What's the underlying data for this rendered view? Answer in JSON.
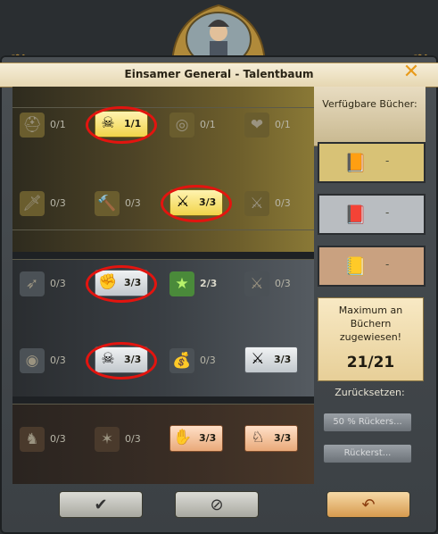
{
  "window": {
    "title": "Einsamer General  - Talentbaum",
    "close_glyph": "✕"
  },
  "talents": [
    {
      "id": "r1c1",
      "icon": "helmet-icon",
      "glyph": "⛑",
      "count": "0/1",
      "state": "locked",
      "tier": "gold"
    },
    {
      "id": "r1c2",
      "icon": "general-portrait-icon",
      "glyph": "☠",
      "count": "1/1",
      "state": "lit",
      "tier": "gold",
      "highlighted": true
    },
    {
      "id": "r1c3",
      "icon": "coin-plus-icon",
      "glyph": "◎",
      "count": "0/1",
      "state": "locked",
      "tier": "gold"
    },
    {
      "id": "r1c4",
      "icon": "heart-icon",
      "glyph": "❤",
      "count": "0/1",
      "state": "locked",
      "tier": "gold"
    },
    {
      "id": "r2c1",
      "icon": "dagger-icon",
      "glyph": "🗡",
      "count": "0/3",
      "state": "locked",
      "tier": "gold"
    },
    {
      "id": "r2c2",
      "icon": "hammer-icon",
      "glyph": "🔨",
      "count": "0/3",
      "state": "locked",
      "tier": "gold"
    },
    {
      "id": "r2c3",
      "icon": "crossed-swords-people-icon",
      "glyph": "⚔",
      "count": "3/3",
      "state": "lit",
      "tier": "gold",
      "highlighted": true
    },
    {
      "id": "r2c4",
      "icon": "swords-clock-icon",
      "glyph": "⚔",
      "count": "0/3",
      "state": "locked",
      "tier": "gold"
    },
    {
      "id": "r3c1",
      "icon": "spearhead-icon",
      "glyph": "➶",
      "count": "0/3",
      "state": "locked",
      "tier": "silver"
    },
    {
      "id": "r3c2",
      "icon": "fist-icon",
      "glyph": "✊",
      "count": "3/3",
      "state": "lit",
      "tier": "silver",
      "highlighted": true
    },
    {
      "id": "r3c3",
      "icon": "green-star-icon",
      "glyph": "★",
      "count": "2/3",
      "state": "partial",
      "tier": "silver"
    },
    {
      "id": "r3c4",
      "icon": "swords-plus-icon",
      "glyph": "⚔",
      "count": "0/3",
      "state": "locked",
      "tier": "silver"
    },
    {
      "id": "r4c1",
      "icon": "target-icon",
      "glyph": "◉",
      "count": "0/3",
      "state": "locked",
      "tier": "silver"
    },
    {
      "id": "r4c2",
      "icon": "skull-heart-icon",
      "glyph": "☠",
      "count": "3/3",
      "state": "lit",
      "tier": "silver",
      "highlighted": true
    },
    {
      "id": "r4c3",
      "icon": "money-bag-icon",
      "glyph": "💰",
      "count": "0/3",
      "state": "locked",
      "tier": "silver"
    },
    {
      "id": "r4c4",
      "icon": "sword-shield-icon",
      "glyph": "⚔",
      "count": "3/3",
      "state": "lit",
      "tier": "silver"
    },
    {
      "id": "r5c1",
      "icon": "horseman-icon",
      "glyph": "♞",
      "count": "0/3",
      "state": "locked",
      "tier": "copper"
    },
    {
      "id": "r5c2",
      "icon": "red-runes-icon",
      "glyph": "✶",
      "count": "0/3",
      "state": "locked",
      "tier": "copper"
    },
    {
      "id": "r5c3",
      "icon": "gauntlet-icon",
      "glyph": "✋",
      "count": "3/3",
      "state": "lit",
      "tier": "copper"
    },
    {
      "id": "r5c4",
      "icon": "horse-icon",
      "glyph": "♘",
      "count": "3/3",
      "state": "lit",
      "tier": "copper"
    }
  ],
  "sidebar": {
    "books_header": "Verfügbare Bücher:",
    "books": [
      {
        "tier": "gold",
        "icon": "gold-book-icon",
        "glyph": "📙",
        "value": "-",
        "color": "#d8c276"
      },
      {
        "tier": "silver",
        "icon": "silver-book-icon",
        "glyph": "📕",
        "value": "-",
        "color": "#b9bdc1"
      },
      {
        "tier": "copper",
        "icon": "copper-book-icon",
        "glyph": "📒",
        "value": "-",
        "color": "#c9a180"
      }
    ],
    "max_text": "Maximum an Büchern zugewiesen!",
    "max_value": "21/21",
    "reset_label": "Zurücksetzen:",
    "reset_percent_label": "50 % Rückers...",
    "reset_full_label": "Rückerst..."
  },
  "footer": {
    "confirm_glyph": "✔",
    "cancel_glyph": "⊘",
    "undo_glyph": "↶"
  },
  "colors": {
    "highlight_ring": "#e3140f",
    "gold_tile": "#f1d44a",
    "silver_tile": "#c2c8cd",
    "copper_tile": "#e9a979"
  }
}
